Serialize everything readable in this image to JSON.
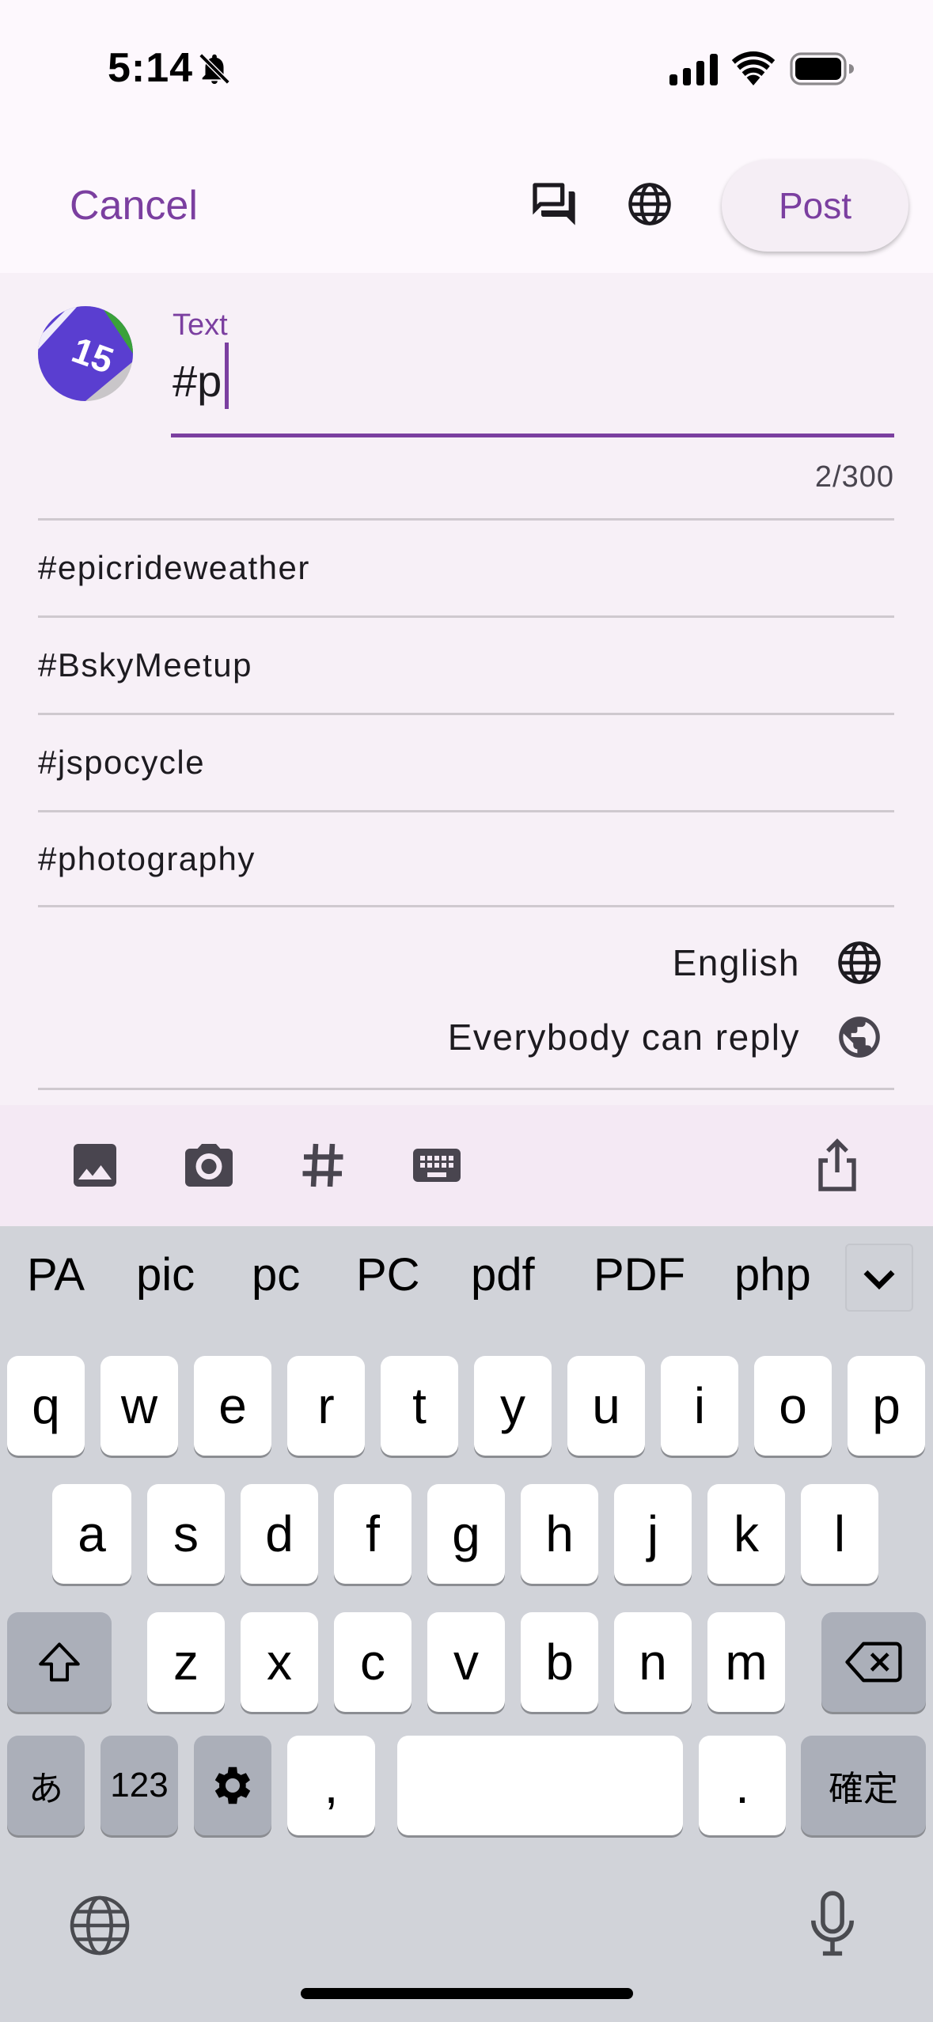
{
  "status_bar": {
    "time": "5:14",
    "icons": [
      "bell-slash-icon",
      "cellular-signal-icon",
      "wifi-icon",
      "battery-icon"
    ]
  },
  "header": {
    "cancel_label": "Cancel",
    "post_label": "Post",
    "icons": [
      "thread-icon",
      "globe-icon"
    ]
  },
  "compose": {
    "field_label": "Text",
    "field_value": "#p",
    "counter": "2/300",
    "suggestions": [
      "#epicrideweather",
      "#BskyMeetup",
      "#jspocycle",
      "#photography"
    ],
    "language": "English",
    "reply_setting": "Everybody can reply",
    "avatar_badge": "15"
  },
  "toolbar": {
    "icons": [
      "image-icon",
      "camera-icon",
      "hashtag-icon",
      "keyboard-icon",
      "share-icon"
    ]
  },
  "keyboard": {
    "predictions": [
      "PA",
      "pic",
      "pc",
      "PC",
      "pdf",
      "PDF",
      "php"
    ],
    "row1": [
      "q",
      "w",
      "e",
      "r",
      "t",
      "y",
      "u",
      "i",
      "o",
      "p"
    ],
    "row2": [
      "a",
      "s",
      "d",
      "f",
      "g",
      "h",
      "j",
      "k",
      "l"
    ],
    "row3": [
      "z",
      "x",
      "c",
      "v",
      "b",
      "n",
      "m"
    ],
    "kana_key": "あ",
    "numbers_key": "123",
    "comma_key": ",",
    "period_key": ".",
    "confirm_key": "確定"
  },
  "colors": {
    "accent": "#7b3fa0",
    "background": "#f7f0f7",
    "toolbar": "#f4e9f4",
    "keyboard": "#d1d3d9"
  }
}
